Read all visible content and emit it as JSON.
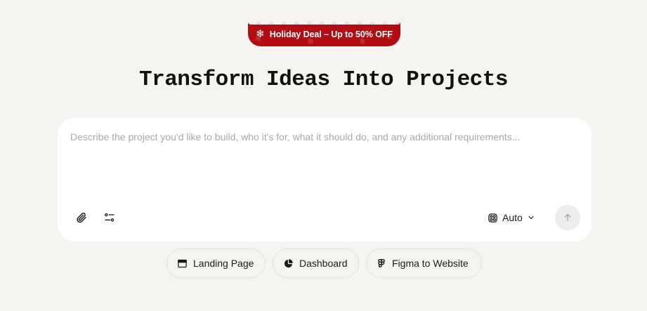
{
  "promo": {
    "label": "Holiday Deal – Up to 50% OFF",
    "icon": "snowflake-icon",
    "background_color": "#b30d14"
  },
  "hero": {
    "title": "Transform Ideas Into Projects"
  },
  "composer": {
    "placeholder": "Describe the project you'd like to build, who it's for, what it should do, and any additional requirements...",
    "value": "",
    "attach_icon": "paperclip-icon",
    "settings_icon": "sliders-icon",
    "model_label": "Auto",
    "model_icon": "model-icon",
    "send_icon": "arrow-up-icon"
  },
  "suggestions": [
    {
      "label": "Landing Page",
      "icon": "browser-window-icon"
    },
    {
      "label": "Dashboard",
      "icon": "pie-chart-icon"
    },
    {
      "label": "Figma to Website",
      "icon": "figma-icon"
    }
  ]
}
